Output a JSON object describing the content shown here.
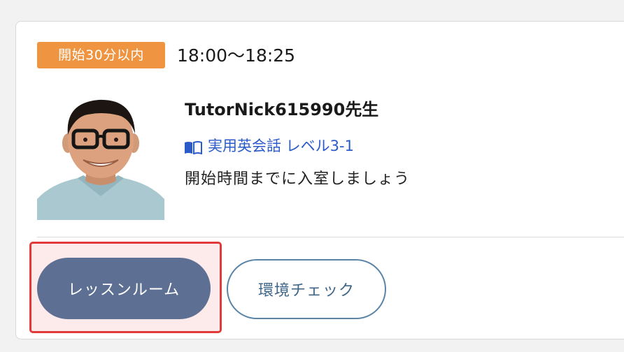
{
  "lesson": {
    "status_badge": "開始30分以内",
    "time_range": "18:00〜18:25",
    "tutor_name": "TutorNick615990先生",
    "course_name": "実用英会話 レベル3-1",
    "note": "開始時間までに入室しましょう"
  },
  "actions": {
    "lesson_room_label": "レッスンルーム",
    "environment_check_label": "環境チェック"
  },
  "icons": {
    "course": "book-icon",
    "avatar": "tutor-avatar"
  },
  "colors": {
    "badge": "#ef9440",
    "link": "#2a5bc9",
    "primary_button": "#5d6f92",
    "secondary_border": "#5a84a6",
    "highlight_border": "#e23a3a"
  }
}
